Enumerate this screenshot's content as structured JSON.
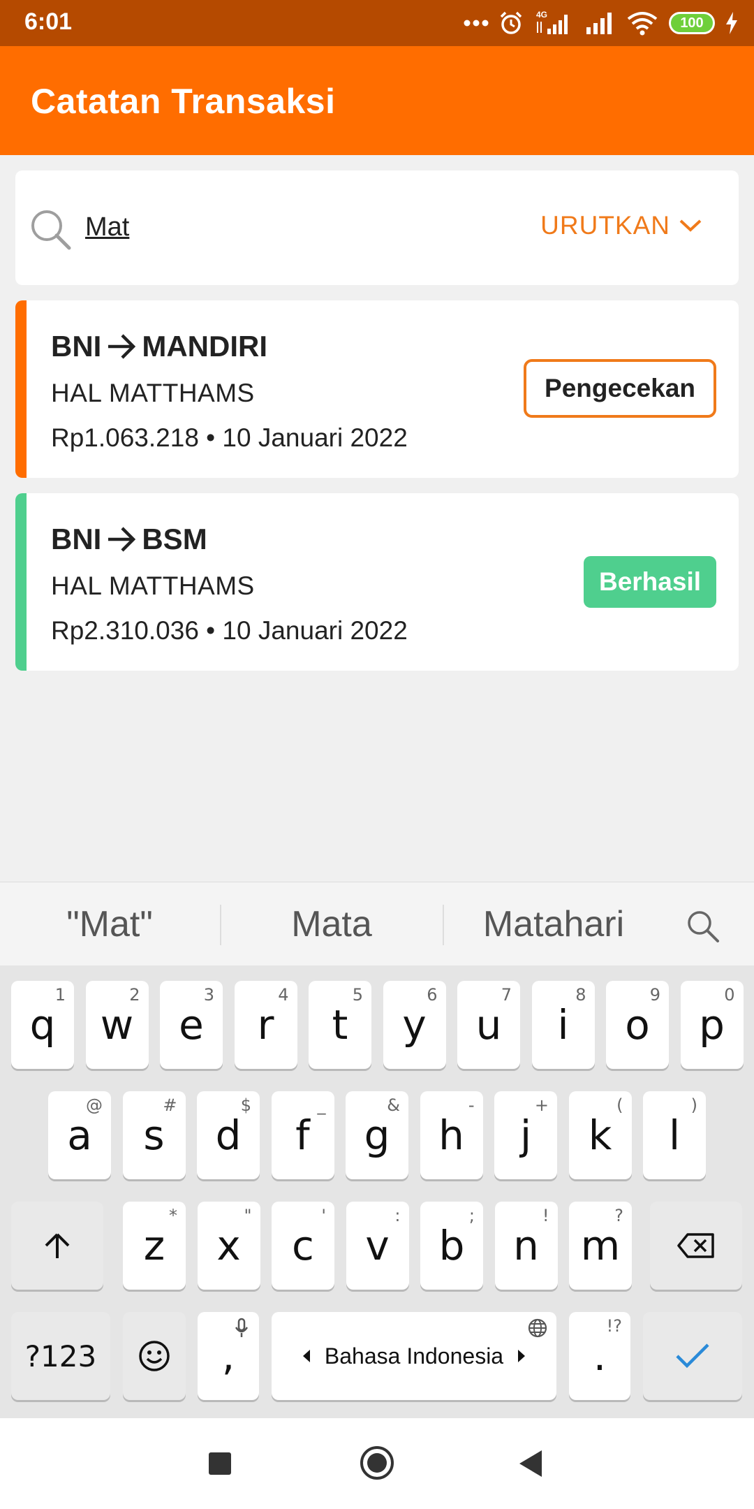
{
  "status_bar": {
    "time": "6:01",
    "network": "4G",
    "battery": "100",
    "icons": [
      "more-dots-icon",
      "alarm-icon",
      "signal-4g-icon",
      "signal-icon",
      "wifi-icon",
      "battery-icon",
      "charging-icon"
    ]
  },
  "app_bar": {
    "title": "Catatan Transaksi"
  },
  "search": {
    "value": "Mat",
    "placeholder": ""
  },
  "sort": {
    "label": "URUTKAN"
  },
  "transactions": [
    {
      "from": "BNI",
      "to": "MANDIRI",
      "name": "HAL MATTHAMS",
      "meta": "Rp1.063.218 • 10 Januari 2022",
      "status": "Pengecekan",
      "accent_color": "#ff6d00"
    },
    {
      "from": "BNI",
      "to": "BSM",
      "name": "HAL MATTHAMS",
      "meta": "Rp2.310.036 • 10 Januari 2022",
      "status": "Berhasil",
      "accent_color": "#4fcf8e"
    }
  ],
  "keyboard": {
    "suggestions": [
      "\"Mat\"",
      "Mata",
      "Matahari"
    ],
    "row1": [
      {
        "k": "q",
        "h": "1"
      },
      {
        "k": "w",
        "h": "2"
      },
      {
        "k": "e",
        "h": "3"
      },
      {
        "k": "r",
        "h": "4"
      },
      {
        "k": "t",
        "h": "5"
      },
      {
        "k": "y",
        "h": "6"
      },
      {
        "k": "u",
        "h": "7"
      },
      {
        "k": "i",
        "h": "8"
      },
      {
        "k": "o",
        "h": "9"
      },
      {
        "k": "p",
        "h": "0"
      }
    ],
    "row2": [
      {
        "k": "a",
        "h": "@"
      },
      {
        "k": "s",
        "h": "#"
      },
      {
        "k": "d",
        "h": "$"
      },
      {
        "k": "f",
        "h": "_"
      },
      {
        "k": "g",
        "h": "&"
      },
      {
        "k": "h",
        "h": "-"
      },
      {
        "k": "j",
        "h": "+"
      },
      {
        "k": "k",
        "h": "("
      },
      {
        "k": "l",
        "h": ")"
      }
    ],
    "row3": [
      {
        "k": "z",
        "h": "*"
      },
      {
        "k": "x",
        "h": "\""
      },
      {
        "k": "c",
        "h": "'"
      },
      {
        "k": "v",
        "h": ":"
      },
      {
        "k": "b",
        "h": ";"
      },
      {
        "k": "n",
        "h": "!"
      },
      {
        "k": "m",
        "h": "?"
      }
    ],
    "symbols_label": "?123",
    "comma_label": ",",
    "period_label": ".",
    "period_hint": "!?",
    "space_label": "Bahasa Indonesia",
    "accent_color": "#2a8ad8"
  },
  "nav_bar": {
    "buttons": [
      "recents-square-icon",
      "home-circle-icon",
      "back-triangle-icon"
    ]
  }
}
